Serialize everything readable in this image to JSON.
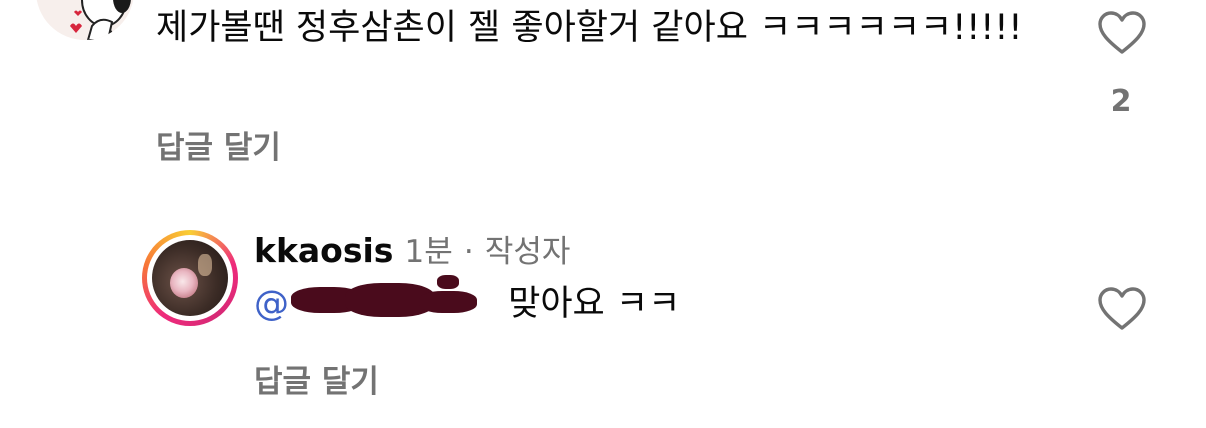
{
  "comment": {
    "text": "제가볼땐 정후삼촌이 젤 좋아할거 같아요 ㅋㅋㅋㅋㅋㅋ!!!!!",
    "reply_label": "답글 달기",
    "like_count": "2",
    "avatar_icon": "snoopy-avatar-icon"
  },
  "reply": {
    "username": "kkaosis",
    "time": "1분",
    "separator": "·",
    "author_badge": "작성자",
    "mention_prefix": "@",
    "text": "맞아요 ㅋㅋ",
    "reply_label": "답글 달기"
  },
  "colors": {
    "text": "#0a0a0a",
    "secondary": "#737373",
    "mention": "#3f62c8",
    "redaction": "#4a0b1c",
    "story_ring": [
      "#f9ce34",
      "#ee2a7b",
      "#f77737"
    ]
  }
}
